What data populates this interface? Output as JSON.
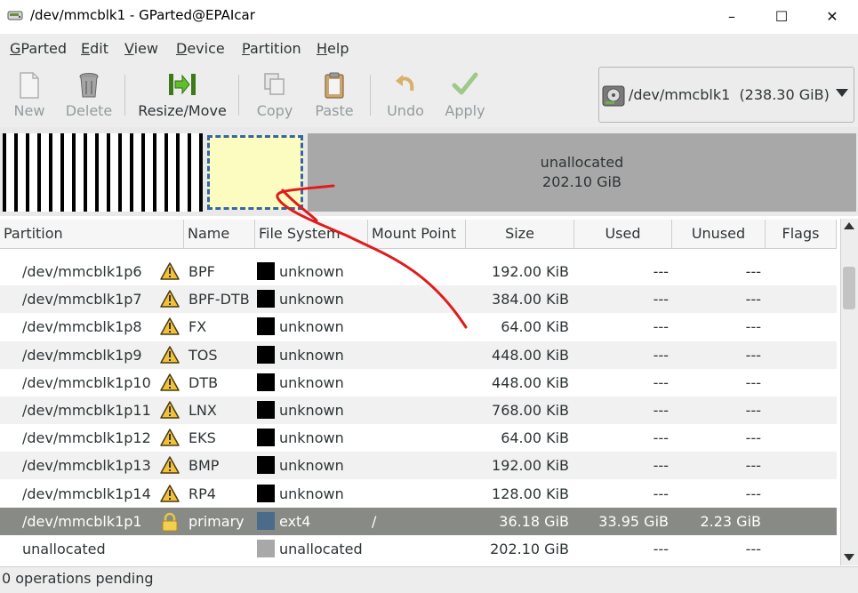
{
  "window": {
    "title": "/dev/mmcblk1 - GParted@EPAIcar",
    "min_glyph": "–",
    "max_glyph": "☐",
    "close_glyph": "✕"
  },
  "menu": {
    "items": [
      {
        "key": "G",
        "rest": "Parted"
      },
      {
        "key": "E",
        "rest": "dit"
      },
      {
        "key": "V",
        "rest": "iew"
      },
      {
        "key": "D",
        "rest": "evice"
      },
      {
        "key": "P",
        "rest": "artition"
      },
      {
        "key": "H",
        "rest": "elp"
      }
    ]
  },
  "toolbar": {
    "new": "New",
    "delete": "Delete",
    "resize": "Resize/Move",
    "copy": "Copy",
    "paste": "Paste",
    "undo": "Undo",
    "apply": "Apply"
  },
  "device": {
    "label": "/dev/mmcblk1  (238.30 GiB)"
  },
  "diskmap": {
    "unallocated_label": "unallocated",
    "unallocated_size": "202.10 GiB"
  },
  "table": {
    "headers": {
      "partition": "Partition",
      "name": "Name",
      "filesystem": "File System",
      "mount": "Mount Point",
      "size": "Size",
      "used": "Used",
      "unused": "Unused",
      "flags": "Flags"
    },
    "rows": [
      {
        "partition": "/dev/mmcblk1p6",
        "name": "BPF",
        "fs": "unknown",
        "mount": "",
        "size": "192.00 KiB",
        "used": "---",
        "unused": "---",
        "flags": ""
      },
      {
        "partition": "/dev/mmcblk1p7",
        "name": "BPF-DTB",
        "fs": "unknown",
        "mount": "",
        "size": "384.00 KiB",
        "used": "---",
        "unused": "---",
        "flags": ""
      },
      {
        "partition": "/dev/mmcblk1p8",
        "name": "FX",
        "fs": "unknown",
        "mount": "",
        "size": "64.00 KiB",
        "used": "---",
        "unused": "---",
        "flags": ""
      },
      {
        "partition": "/dev/mmcblk1p9",
        "name": "TOS",
        "fs": "unknown",
        "mount": "",
        "size": "448.00 KiB",
        "used": "---",
        "unused": "---",
        "flags": ""
      },
      {
        "partition": "/dev/mmcblk1p10",
        "name": "DTB",
        "fs": "unknown",
        "mount": "",
        "size": "448.00 KiB",
        "used": "---",
        "unused": "---",
        "flags": ""
      },
      {
        "partition": "/dev/mmcblk1p11",
        "name": "LNX",
        "fs": "unknown",
        "mount": "",
        "size": "768.00 KiB",
        "used": "---",
        "unused": "---",
        "flags": ""
      },
      {
        "partition": "/dev/mmcblk1p12",
        "name": "EKS",
        "fs": "unknown",
        "mount": "",
        "size": "64.00 KiB",
        "used": "---",
        "unused": "---",
        "flags": ""
      },
      {
        "partition": "/dev/mmcblk1p13",
        "name": "BMP",
        "fs": "unknown",
        "mount": "",
        "size": "192.00 KiB",
        "used": "---",
        "unused": "---",
        "flags": ""
      },
      {
        "partition": "/dev/mmcblk1p14",
        "name": "RP4",
        "fs": "unknown",
        "mount": "",
        "size": "128.00 KiB",
        "used": "---",
        "unused": "---",
        "flags": ""
      },
      {
        "partition": "/dev/mmcblk1p1",
        "name": "primary",
        "fs": "ext4",
        "mount": "/",
        "size": "36.18 GiB",
        "used": "33.95 GiB",
        "unused": "2.23 GiB",
        "flags": ""
      },
      {
        "partition": "unallocated",
        "name": "",
        "fs": "unallocated",
        "mount": "",
        "size": "202.10 GiB",
        "used": "---",
        "unused": "---",
        "flags": ""
      }
    ]
  },
  "colors": {
    "unknown_fs": "#000000",
    "ext4_fs": "#4a6b8a",
    "unallocated_fs": "#a8a8a8",
    "selection": "#888a85",
    "annotation": "#e11b1b"
  },
  "status": {
    "text": "0 operations pending"
  }
}
